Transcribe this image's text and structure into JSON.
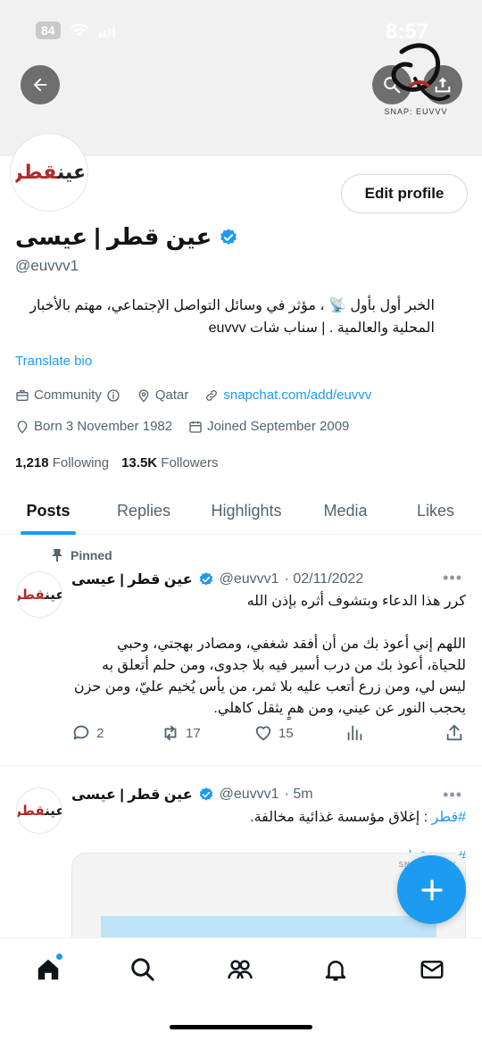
{
  "status_bar": {
    "time": "8:57",
    "battery": "84"
  },
  "header": {
    "watermark_text": "SNAP: EUVVV"
  },
  "profile": {
    "name": "عين قطر | عيسى",
    "handle": "@euvvv1",
    "edit_button": "Edit profile",
    "bio_line1": "الخبر أول بأول 📡 ، مؤثر في وسائل التواصل الإجتماعي، مهتم بالأخبار",
    "bio_line2": "المحلية والعالمية . | سناب شات euvvv",
    "translate": "Translate bio",
    "category": "Community",
    "location": "Qatar",
    "link": "snapchat.com/add/euvvv",
    "born": "Born 3 November 1982",
    "joined": "Joined September 2009",
    "following_count": "1,218",
    "following_label": "Following",
    "followers_count": "13.5K",
    "followers_label": "Followers"
  },
  "tabs": [
    {
      "label": "Posts"
    },
    {
      "label": "Replies"
    },
    {
      "label": "Highlights"
    },
    {
      "label": "Media"
    },
    {
      "label": "Likes"
    }
  ],
  "posts": [
    {
      "pinned_label": "Pinned",
      "name": "عين قطر | عيسى",
      "handle": "@euvvv1",
      "time": "· 02/11/2022",
      "line1": "كرر هذا الدعاء وبتشوف أثره بإذن الله",
      "line2": "اللهم إني أعوذ بك من أن أفقد شغفي، ومصادر بهجتي، وحبي",
      "line3": "للحياة، أعوذ بك من درب أسير فيه بلا جدوى، ومن حلم أتعلق به",
      "line4": "ليس لي، ومن زرع أتعب عليه بلا ثمر، من يأس يُخيم عليّ، ومن حزن",
      "line5": "يحجب النور عن عيني، ومن همٍ يثقل كاهلي.",
      "replies": "2",
      "reposts": "17",
      "likes": "15"
    },
    {
      "name": "عين قطر | عيسى",
      "handle": "@euvvv1",
      "time": "· 5m",
      "hashtag": "#قطر",
      "text": " : إغلاق مؤسسة غذائية مخالفة.",
      "hashtag2": "#عين_قطر"
    }
  ],
  "avatar_text": {
    "black": "عين",
    "red": "قطر"
  },
  "colors": {
    "accent": "#1d9bf0",
    "text": "#0f1419",
    "muted": "#536471"
  }
}
